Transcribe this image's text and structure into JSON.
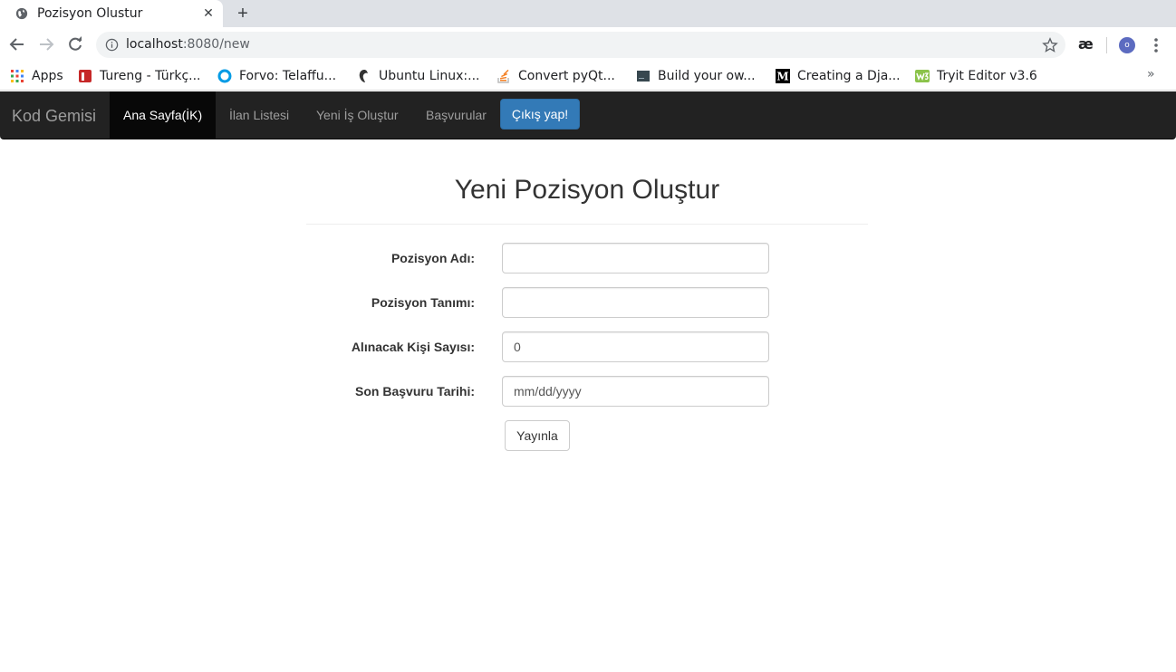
{
  "browser": {
    "tab_title": "Pozisyon Olustur",
    "new_tab_glyph": "+",
    "url_host": "localhost",
    "url_rest": ":8080/new",
    "extension_label": "æ",
    "avatar_letter": "o",
    "bookmarks": [
      {
        "label": "Apps",
        "icon": "apps-grid-icon"
      },
      {
        "label": "Tureng - Türkç...",
        "icon": "tureng-icon",
        "color": "#c62828"
      },
      {
        "label": "Forvo: Telaffu...",
        "icon": "forvo-icon",
        "color": "#039be5"
      },
      {
        "label": "Ubuntu Linux:...",
        "icon": "ubuntu-icon",
        "color": "#333333"
      },
      {
        "label": "Convert pyQt...",
        "icon": "stackoverflow-icon",
        "color": "#f48024"
      },
      {
        "label": "Build your ow...",
        "icon": "book-icon",
        "color": "#37474f"
      },
      {
        "label": "Creating a Dja...",
        "icon": "medium-icon",
        "color": "#000000"
      },
      {
        "label": "Tryit Editor v3.6",
        "icon": "w3schools-icon",
        "color": "#8bc34a"
      }
    ],
    "more_bookmarks": "»"
  },
  "navbar": {
    "brand": "Kod Gemisi",
    "items": [
      {
        "label": "Ana Sayfa(İK)",
        "active": true
      },
      {
        "label": "İlan Listesi",
        "active": false
      },
      {
        "label": "Yeni İş Oluştur",
        "active": false
      },
      {
        "label": "Başvurular",
        "active": false
      }
    ],
    "logout_label": "Çıkış yap!"
  },
  "form": {
    "title": "Yeni Pozisyon Oluştur",
    "fields": [
      {
        "label": "Pozisyon Adı:",
        "value": "",
        "placeholder": ""
      },
      {
        "label": "Pozisyon Tanımı:",
        "value": "",
        "placeholder": ""
      },
      {
        "label": "Alınacak Kişi Sayısı:",
        "value": "0",
        "placeholder": ""
      },
      {
        "label": "Son Başvuru Tarihi:",
        "value": "",
        "placeholder": "mm/dd/yyyy"
      }
    ],
    "submit_label": "Yayınla"
  },
  "colors": {
    "navbar_bg": "#222222",
    "active_nav_bg": "#080808",
    "logout_btn": "#337ab7"
  }
}
